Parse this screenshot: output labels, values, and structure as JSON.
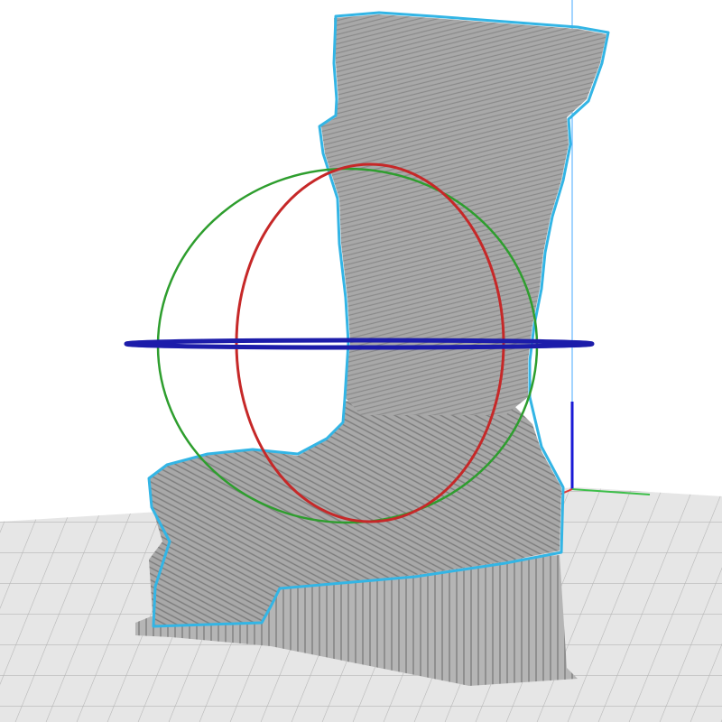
{
  "viewport": {
    "background_color": "#ffffff",
    "build_plate_color": "#e6e6e6",
    "grid_line_color": "#b4b4b4"
  },
  "model": {
    "shape": "boot",
    "fill_color": "#a8a8a8",
    "selection_outline_color": "#33b5e5"
  },
  "axes": {
    "x_color": "#e53935",
    "y_color": "#3dbf4a",
    "z_color": "#1a1ad6",
    "vertical_guide_color": "#44aaff"
  },
  "rotate_tool": {
    "x_ring_color": "#c62828",
    "y_ring_color": "#2e9e2e",
    "z_ring_color": "#1c1caa"
  }
}
